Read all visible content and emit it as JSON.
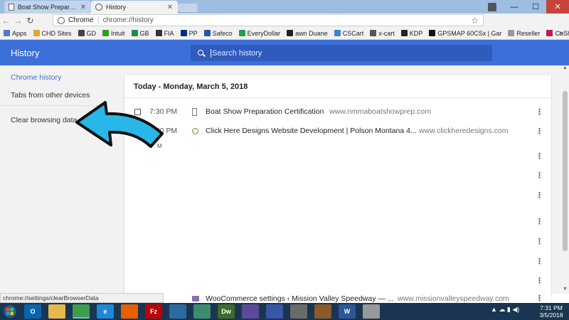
{
  "colors": {
    "header_blue": "#3d6fd9",
    "search_blue": "#2f5bbd",
    "accent_arrow": "#29b6e8"
  },
  "tabs": [
    {
      "label": "Boat Show Preparation C",
      "icon": "document-icon",
      "active": false
    },
    {
      "label": "History",
      "icon": "history-icon",
      "active": true
    }
  ],
  "toolbar": {
    "site_chip": "Chrome",
    "url": "chrome://history"
  },
  "bookmarks": [
    {
      "label": "Apps",
      "color": "#4b7bd1"
    },
    {
      "label": "CHD Sites",
      "color": "#e0a82c"
    },
    {
      "label": "GD",
      "color": "#444444"
    },
    {
      "label": "Intuit",
      "color": "#2ca01c"
    },
    {
      "label": "GB",
      "color": "#1f8b4c"
    },
    {
      "label": "FIA",
      "color": "#333333"
    },
    {
      "label": "PP",
      "color": "#003087"
    },
    {
      "label": "Safeco",
      "color": "#1d5aa8"
    },
    {
      "label": "EveryDollar",
      "color": "#1ea34a"
    },
    {
      "label": "awn Duane",
      "color": "#222222"
    },
    {
      "label": "CSCart",
      "color": "#3a87c8"
    },
    {
      "label": "x-cart",
      "color": "#555555"
    },
    {
      "label": "KDP",
      "color": "#222222"
    },
    {
      "label": "GPSMAP 60CSx | Gar",
      "color": "#111111"
    },
    {
      "label": "Reseller",
      "color": "#999999"
    },
    {
      "label": "CoShare",
      "color": "#c2185b"
    }
  ],
  "header": {
    "title": "History",
    "search_placeholder": "Search history"
  },
  "sidebar": {
    "items": [
      {
        "label": "Chrome history",
        "selected": true
      },
      {
        "label": "Tabs from other devices",
        "selected": false
      },
      {
        "label": "Clear browsing data",
        "selected": false
      }
    ]
  },
  "history": {
    "day_heading": "Today - Monday, March 5, 2018",
    "rows": [
      {
        "time": "7:30 PM",
        "title": "Boat Show Preparation Certification",
        "domain": "www.nmmaboatshowprep.com"
      },
      {
        "time": "7:30 PM",
        "title": "Click Here Designs Website Development | Polson Montana 4...",
        "domain": "www.clickheredesigns.com"
      }
    ],
    "partial_row": {
      "title": "WooCommerce settings ‹ Mission Valley Speedway — ...",
      "domain": "www.missionvalleyspeedway.com"
    },
    "partial_time": "M"
  },
  "status_bar": {
    "url": "chrome://settings/clearBrowserData"
  },
  "taskbar": {
    "icons": [
      {
        "name": "outlook",
        "label": "O",
        "color": "#0a64ad"
      },
      {
        "name": "file-explorer",
        "label": "",
        "color": "#e8b84a"
      },
      {
        "name": "chrome",
        "label": "",
        "color": "#3e9d4b"
      },
      {
        "name": "internet-explorer",
        "label": "e",
        "color": "#1e88d6"
      },
      {
        "name": "firefox",
        "label": "",
        "color": "#e66000"
      },
      {
        "name": "filezilla",
        "label": "Fz",
        "color": "#bf0000"
      },
      {
        "name": "fetch",
        "label": "",
        "color": "#2c6aa0"
      },
      {
        "name": "feather-app",
        "label": "",
        "color": "#3b8d6e"
      },
      {
        "name": "dreamweaver",
        "label": "Dw",
        "color": "#3c6c2a"
      },
      {
        "name": "publisher",
        "label": "",
        "color": "#5b4a9c"
      },
      {
        "name": "visio",
        "label": "",
        "color": "#3955a3"
      },
      {
        "name": "photos",
        "label": "",
        "color": "#6b6b6b"
      },
      {
        "name": "library",
        "label": "",
        "color": "#8a5a2b"
      },
      {
        "name": "word",
        "label": "W",
        "color": "#2b579a"
      },
      {
        "name": "snipping",
        "label": "",
        "color": "#999999"
      }
    ],
    "clock_time": "7:31 PM",
    "clock_date": "3/5/2018"
  }
}
